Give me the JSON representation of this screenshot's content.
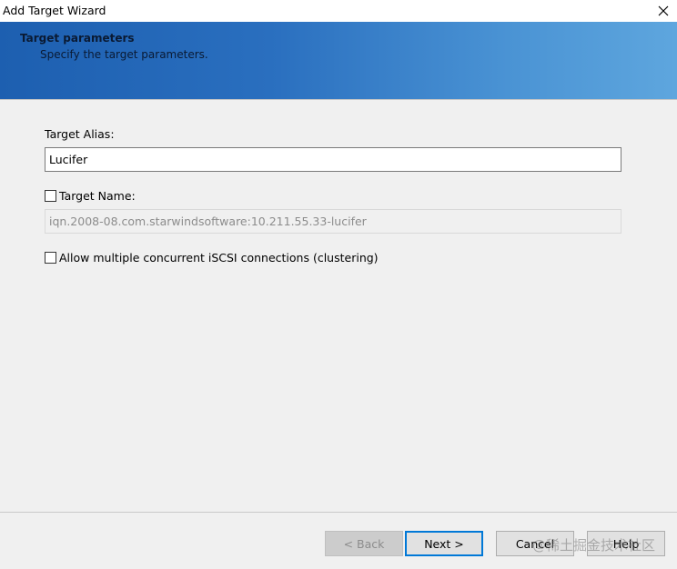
{
  "window": {
    "title": "Add Target Wizard"
  },
  "banner": {
    "title": "Target parameters",
    "subtitle": "Specify the target parameters."
  },
  "form": {
    "alias_label": "Target Alias:",
    "alias_value": "Lucifer",
    "name_label": "Target Name:",
    "name_checked": false,
    "name_value": "iqn.2008-08.com.starwindsoftware:10.211.55.33-lucifer",
    "clustering_label": "Allow multiple concurrent iSCSI connections (clustering)",
    "clustering_checked": false
  },
  "buttons": {
    "back": "< Back",
    "next": "Next >",
    "cancel": "Cancel",
    "help": "Help"
  },
  "watermark": "@稀土掘金技术社区",
  "colors": {
    "banner_start": "#1d5fb0",
    "banner_end": "#5ea6de",
    "focus_accent": "#0078d7"
  }
}
